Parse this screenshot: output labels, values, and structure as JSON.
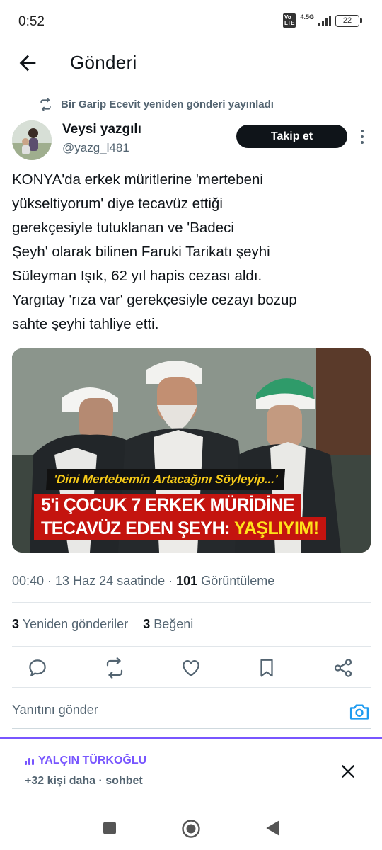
{
  "status_bar": {
    "time": "0:52",
    "volte": "Vo LTE",
    "network": "4.5G",
    "battery": "22"
  },
  "header": {
    "title": "Gönderi",
    "back_icon": "arrow-left-icon"
  },
  "repost": {
    "text": "Bir Garip Ecevit yeniden gönderi yayınladı",
    "icon": "repost-icon"
  },
  "author": {
    "name": "Veysi yazgılı",
    "handle": "@yazg_l481",
    "follow_label": "Takip et"
  },
  "tweet": {
    "lines": [
      "KONYA'da erkek müritlerine 'mertebeni",
      "yükseltiyorum' diye tecavüz ettiği",
      "gerekçesiyle tutuklanan ve 'Badeci",
      "Şeyh' olarak bilinen Faruki Tarikatı şeyhi",
      "Süleyman Işık, 62 yıl hapis cezası aldı.",
      "Yargıtay 'rıza var' gerekçesiyle cezayı bozup",
      "sahte şeyhi tahliye etti."
    ]
  },
  "media": {
    "caption_top": "'Dini Mertebemin Artacağını Söyleyip...'",
    "caption_line1": "5'i ÇOCUK 7 ERKEK MÜRİDİNE",
    "caption_line2_a": "TECAVÜZ EDEN ŞEYH: ",
    "caption_line2_b": "YAŞLIYIM!"
  },
  "meta": {
    "time": "00:40",
    "date_text": "13 Haz 24 saatinde",
    "views": "101",
    "views_label": "Görüntüleme"
  },
  "stats": {
    "reposts": "3",
    "reposts_label": "Yeniden gönderiler",
    "likes": "3",
    "likes_label": "Beğeni"
  },
  "actions": [
    "reply-icon",
    "repost-icon",
    "like-icon",
    "bookmark-icon",
    "share-icon"
  ],
  "reply": {
    "placeholder": "Yanıtını gönder"
  },
  "spaces": {
    "host": "YALÇIN TÜRKOĞLU",
    "subtitle": "+32 kişi daha · sohbet"
  },
  "colors": {
    "accent": "#7856ff",
    "text": "#0f1419",
    "muted": "#536471",
    "link": "#1d9bf0",
    "caption_red": "#c4140f",
    "caption_yellow": "#f5c918"
  }
}
